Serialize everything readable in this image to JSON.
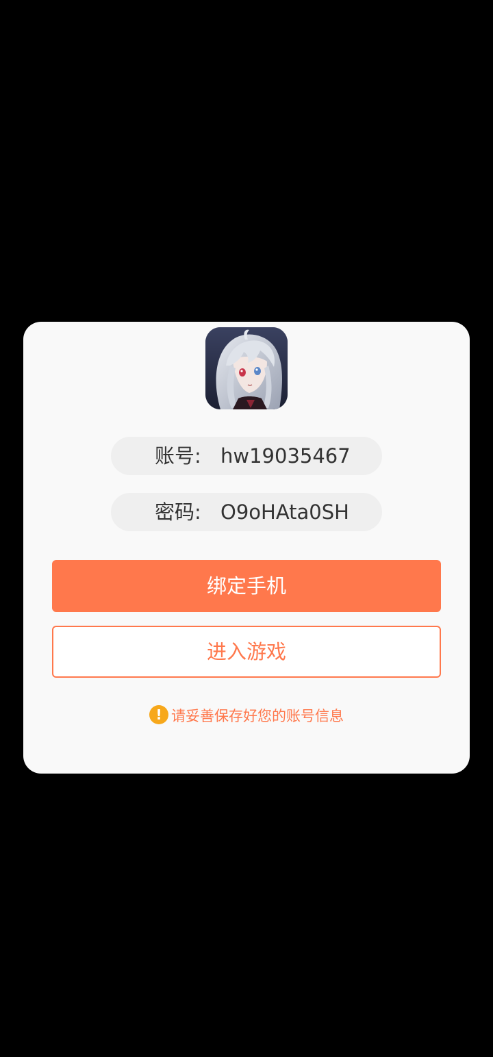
{
  "dialog": {
    "avatar_icon": "anime-character-avatar-icon",
    "account": {
      "label": "账号:",
      "value": "hw19035467"
    },
    "password": {
      "label": "密码:",
      "value": "O9oHAta0SH"
    },
    "bind_phone_button": "绑定手机",
    "enter_game_button": "进入游戏",
    "notice": {
      "icon": "warning-icon",
      "text": "请妥善保存好您的账号信息"
    }
  },
  "colors": {
    "accent": "#ff784c",
    "warning": "#f7a81b",
    "card_bg": "#f9f9f9",
    "field_bg": "#efefef",
    "backdrop": "#000000"
  }
}
